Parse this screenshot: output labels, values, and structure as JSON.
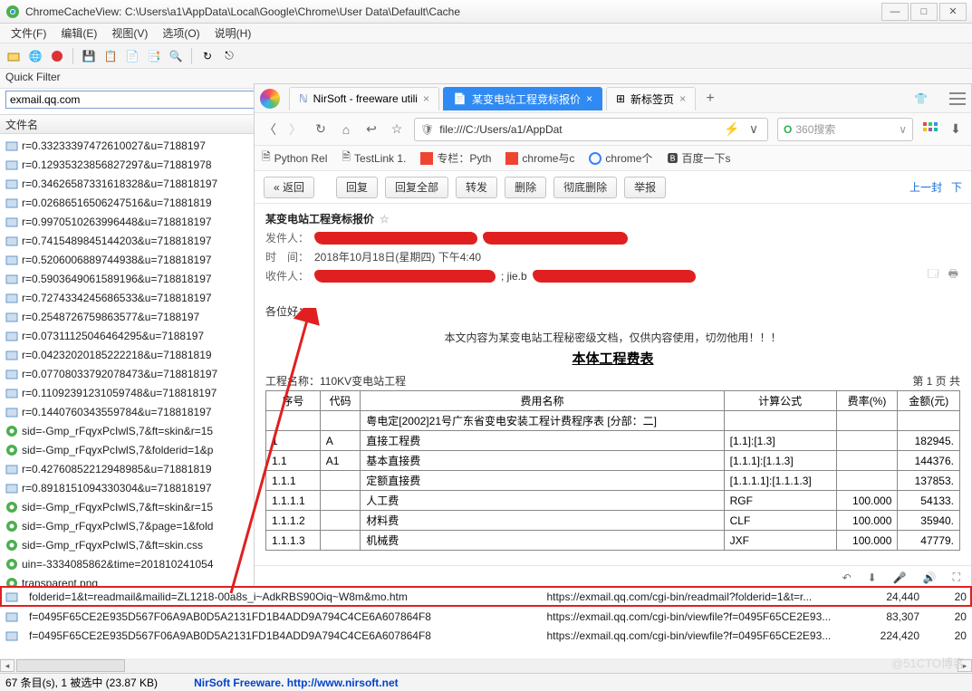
{
  "window": {
    "title": "ChromeCacheView:  C:\\Users\\a1\\AppData\\Local\\Google\\Chrome\\User Data\\Default\\Cache"
  },
  "menu": {
    "file": "文件(F)",
    "edit": "编辑(E)",
    "view": "视图(V)",
    "options": "选项(O)",
    "help": "说明(H)"
  },
  "quickfilter": {
    "label": "Quick Filter",
    "value": "exmail.qq.com"
  },
  "listheader": "文件名",
  "files": [
    "r=0.33233397472610027&u=7188197",
    "r=0.12935323856827297&u=71881978",
    "r=0.34626587331618328&u=718818197",
    "r=0.02686516506247516&u=71881819",
    "r=0.9970510263996448&u=718818197",
    "r=0.7415489845144203&u=718818197",
    "r=0.5206006889744938&u=718818197",
    "r=0.5903649061589196&u=718818197",
    "r=0.7274334245686533&u=718818197",
    "r=0.2548726759863577&u=7188197",
    "r=0.07311125046464295&u=7188197",
    "r=0.04232020185222218&u=71881819",
    "r=0.07708033792078473&u=718818197",
    "r=0.11092391231059748&u=718818197",
    "r=0.1440760343559784&u=718818197",
    "sid=-Gmp_rFqyxPcIwlS,7&ft=skin&r=15",
    "sid=-Gmp_rFqyxPcIwlS,7&folderid=1&p",
    "r=0.42760852212948985&u=71881819",
    "r=0.8918151094330304&u=718818197",
    "sid=-Gmp_rFqyxPcIwlS,7&ft=skin&r=15",
    "sid=-Gmp_rFqyxPcIwlS,7&page=1&fold",
    "sid=-Gmp_rFqyxPcIwlS,7&ft=skin.css",
    "uin=-3334085862&time=201810241054",
    "transparent.png"
  ],
  "bottom": [
    {
      "name": "folderid=1&t=readmail&mailid=ZL1218-00a8s_i~AdkRBS90Oiq~W8m&mo.htm",
      "url": "https://exmail.qq.com/cgi-bin/readmail?folderid=1&t=r...",
      "size": "24,440",
      "n": "20",
      "selected": true
    },
    {
      "name": "f=0495F65CE2E935D567F06A9AB0D5A2131FD1B4ADD9A794C4CE6A607864F8",
      "url": "https://exmail.qq.com/cgi-bin/viewfile?f=0495F65CE2E93...",
      "size": "83,307",
      "n": "20",
      "selected": false
    },
    {
      "name": "f=0495F65CE2E935D567F06A9AB0D5A2131FD1B4ADD9A794C4CE6A607864F8",
      "url": "https://exmail.qq.com/cgi-bin/viewfile?f=0495F65CE2E93...",
      "size": "224,420",
      "n": "20",
      "selected": false
    }
  ],
  "status": {
    "left": "67 条目(s), 1 被选中  (23.87 KB)",
    "right": "NirSoft Freeware.  http://www.nirsoft.net"
  },
  "watermark": "@51CTO博客",
  "browser": {
    "tabs": [
      {
        "label": "NirSoft - freeware utili",
        "active": false
      },
      {
        "label": "某变电站工程竞标报价",
        "active": true
      },
      {
        "label": "新标签页",
        "active": false
      }
    ],
    "address": "file:///C:/Users/a1/AppDat",
    "search_placeholder": "360搜索",
    "bookmarks": [
      "Python Rel",
      "TestLink 1.",
      "专栏：Pyth",
      "chrome与c",
      "chrome个",
      "百度一下s"
    ],
    "actions": {
      "back": "« 返回",
      "reply": "回复",
      "replyall": "回复全部",
      "forward": "转发",
      "delete": "删除",
      "harddelete": "彻底删除",
      "report": "举报",
      "prev": "上一封",
      "next": "下"
    },
    "mail": {
      "subject": "某变电站工程竞标报价",
      "sender_label": "发件人：",
      "time_label": "时　间：",
      "time_value": "2018年10月18日(星期四) 下午4:40",
      "recipient_label": "收件人：",
      "greet": "各位好：",
      "warn": "本文内容为某变电站工程秘密级文档，仅供内容使用，切勿他用！！！",
      "tabletitle": "本体工程费表",
      "project_label": "工程名称：",
      "project_name": "110KV变电站工程",
      "page_info": "第 1 页 共",
      "headers": [
        "序号",
        "代码",
        "费用名称",
        "计算公式",
        "费率(%)",
        "金额(元)"
      ],
      "rows": [
        [
          "",
          "",
          "粤电定[2002]21号广东省变电安装工程计费程序表 [分部：二]",
          "",
          "",
          ""
        ],
        [
          "1",
          "A",
          "直接工程费",
          "[1.1]:[1.3]",
          "",
          "182945."
        ],
        [
          "1.1",
          "A1",
          "基本直接费",
          "[1.1.1]:[1.1.3]",
          "",
          "144376."
        ],
        [
          "1.1.1",
          "",
          "定额直接费",
          "[1.1.1.1]:[1.1.1.3]",
          "",
          "137853."
        ],
        [
          "1.1.1.1",
          "",
          "人工费",
          "RGF",
          "100.000",
          "54133."
        ],
        [
          "1.1.1.2",
          "",
          "材料费",
          "CLF",
          "100.000",
          "35940."
        ],
        [
          "1.1.1.3",
          "",
          "机械费",
          "JXF",
          "100.000",
          "47779."
        ]
      ]
    }
  }
}
